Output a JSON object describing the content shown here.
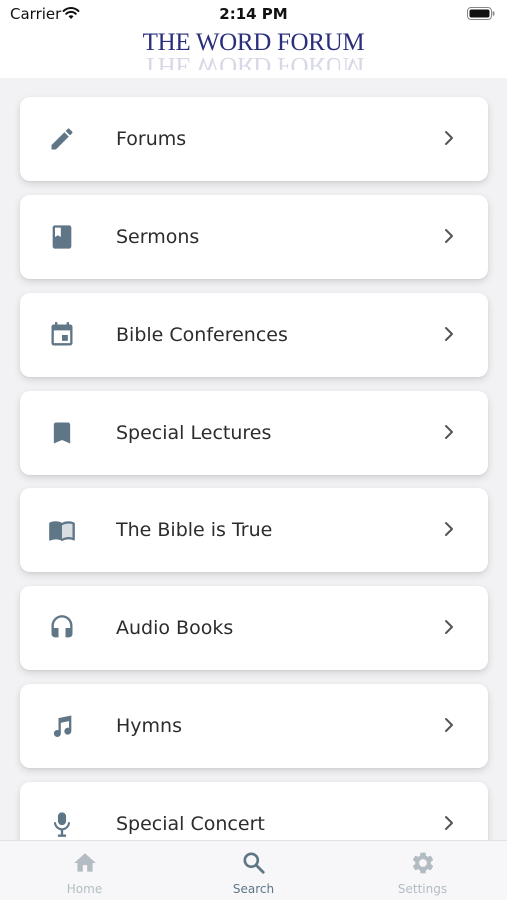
{
  "status_bar": {
    "carrier": "Carrier",
    "time": "2:14 PM"
  },
  "header": {
    "logo_text": "THE WORD FORUM"
  },
  "menu": [
    {
      "label": "Forums",
      "icon": "pencil-icon"
    },
    {
      "label": "Sermons",
      "icon": "book-icon"
    },
    {
      "label": "Bible Conferences",
      "icon": "calendar-icon"
    },
    {
      "label": "Special Lectures",
      "icon": "bookmark-icon"
    },
    {
      "label": "The Bible is True",
      "icon": "open-book-icon"
    },
    {
      "label": "Audio Books",
      "icon": "headphones-icon"
    },
    {
      "label": "Hymns",
      "icon": "music-note-icon"
    },
    {
      "label": "Special Concert",
      "icon": "microphone-icon"
    }
  ],
  "tabbar": {
    "tabs": [
      {
        "label": "Home",
        "icon": "home-icon",
        "active": false
      },
      {
        "label": "Search",
        "icon": "search-icon",
        "active": true
      },
      {
        "label": "Settings",
        "icon": "gear-icon",
        "active": false
      }
    ]
  },
  "colors": {
    "icon": "#5f7687",
    "brand": "#2a2f7c",
    "tab_active": "#5f7687",
    "tab_inactive": "#b3bcc3"
  }
}
